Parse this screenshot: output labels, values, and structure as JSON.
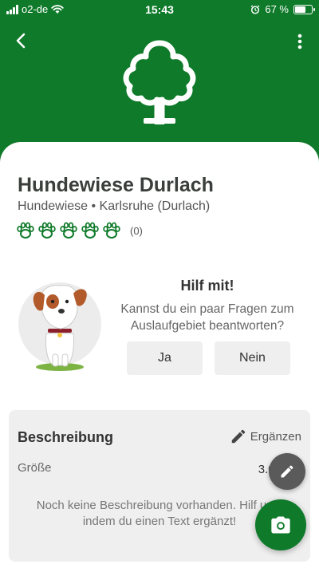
{
  "status_bar": {
    "carrier": "o2-de",
    "time": "15:43",
    "battery": "67 %",
    "battery_level": 0.67,
    "icons": [
      "signal-icon",
      "wifi-icon",
      "alarm-icon",
      "battery-icon"
    ]
  },
  "header": {
    "back_icon": "back-arrow-icon",
    "menu_icon": "more-vertical-icon",
    "logo_icon": "tree-icon",
    "background_color": "#0f7a2a"
  },
  "place": {
    "title": "Hundewiese Durlach",
    "subtitle": "Hundewiese • Karlsruhe (Durlach)",
    "rating_count": "(0)",
    "rating_stars": 0,
    "rating_max": 5
  },
  "help": {
    "title": "Hilf mit!",
    "text": "Kannst du ein paar Fragen zum Auslaufgebiet beantworten?",
    "yes_label": "Ja",
    "no_label": "Nein"
  },
  "description": {
    "title": "Beschreibung",
    "edit_label": "Ergänzen",
    "size_label": "Größe",
    "size_value": "3.000 m",
    "empty_text": "Noch keine Beschreibung vorhanden. Hilf uns, indem du einen Text ergänzt!"
  },
  "fab": {
    "edit_icon": "pencil-icon",
    "camera_icon": "camera-icon"
  },
  "colors": {
    "accent": "#0f7a2a",
    "paw": "#0f7a2a",
    "fab_dark": "#5a5a5a"
  }
}
